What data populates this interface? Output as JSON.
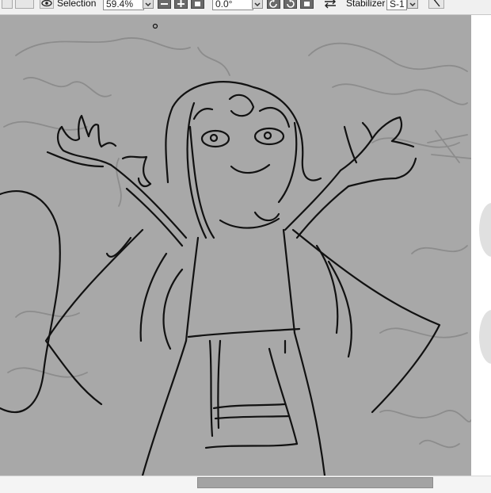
{
  "toolbar": {
    "selection_label": "Selection",
    "zoom_value": "59.4%",
    "rotation_value": "0.0°",
    "stabilizer_label": "Stabilizer",
    "stabilizer_value": "S-1"
  },
  "icons": {
    "eye": "eye-icon",
    "zoom_out": "minus-icon",
    "zoom_in": "plus-icon",
    "rotate_ccw": "rotate-left-icon",
    "rotate_cw": "rotate-right-icon",
    "flip": "flip-icon",
    "pen": "pen-icon"
  },
  "colors": {
    "canvas_bg": "#a8a8a8",
    "stroke_dark": "#111111",
    "stroke_light": "#8c8c8c"
  }
}
